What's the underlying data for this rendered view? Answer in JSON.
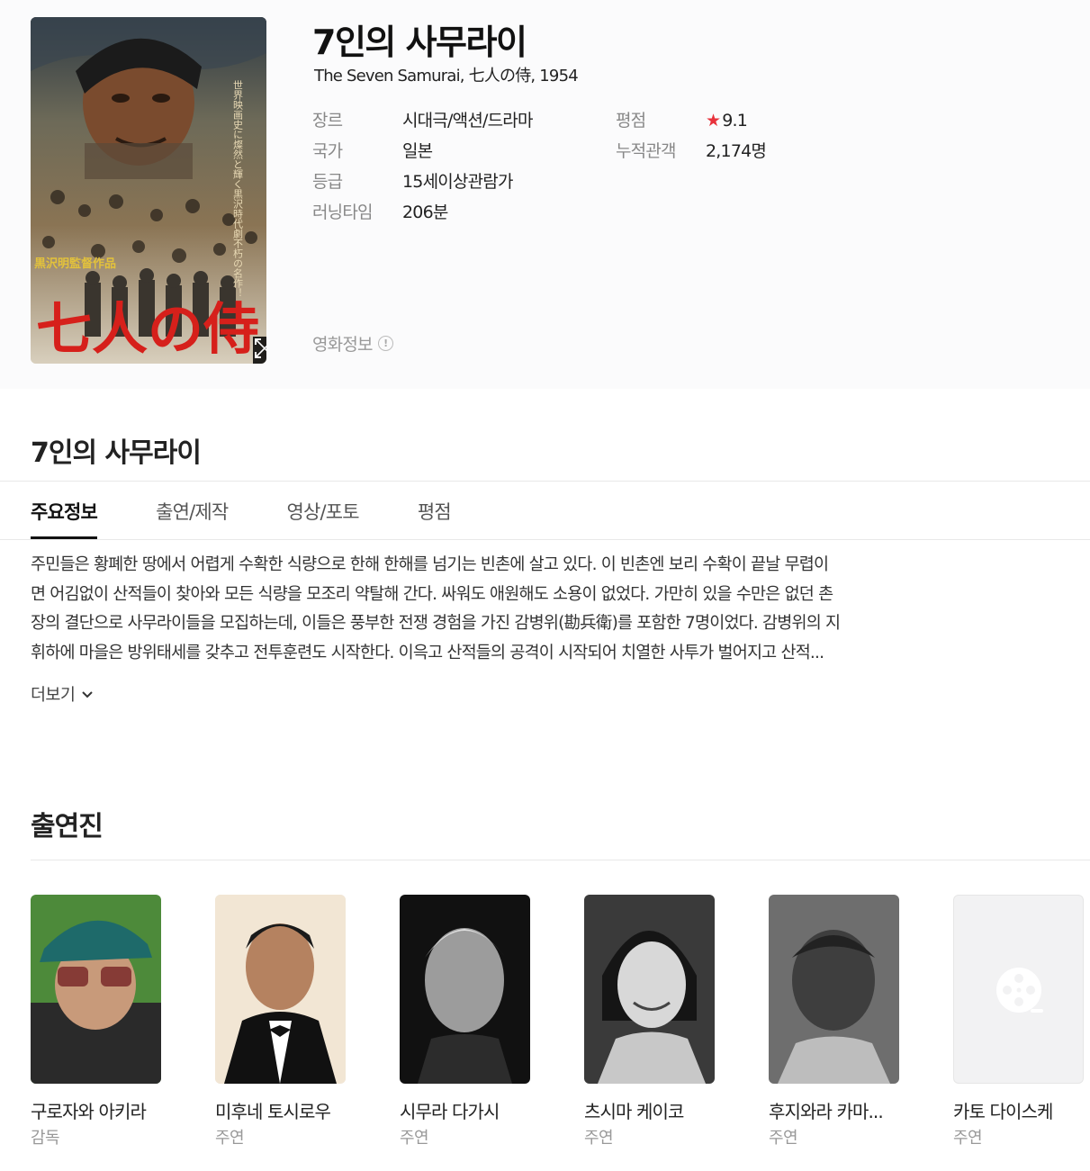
{
  "movie": {
    "title": "7인의 사무라이",
    "subtitle": "The Seven Samurai, 七人の侍, 1954",
    "poster_text_title": "七人の侍",
    "poster_text_credit": "黒沢明監督作品",
    "poster_text_tagline": "世界映画史に燦然と輝く黒沢時代劇不朽の名作！",
    "info_left": [
      {
        "label": "장르",
        "value": "시대극/액션/드라마"
      },
      {
        "label": "국가",
        "value": "일본"
      },
      {
        "label": "등급",
        "value": "15세이상관람가"
      },
      {
        "label": "러닝타임",
        "value": "206분"
      }
    ],
    "info_right": [
      {
        "label": "평점",
        "value": "9.1"
      },
      {
        "label": "누적관객",
        "value": "2,174명"
      }
    ],
    "rating_star_icon": "★",
    "movie_info_link": "영화정보",
    "movie_info_icon": "!"
  },
  "section_title": "7인의 사무라이",
  "tabs": [
    "주요정보",
    "출연/제작",
    "영상/포토",
    "평점"
  ],
  "synopsis": [
    "주민들은 황폐한 땅에서 어렵게 수확한 식량으로 한해 한해를 넘기는 빈촌에 살고 있다. 이 빈촌엔 보리 수확이 끝날 무렵이",
    "면 어김없이 산적들이 찾아와 모든 식량을 모조리 약탈해 간다. 싸워도 애원해도 소용이 없었다. 가만히 있을 수만은 없던 촌",
    "장의 결단으로 사무라이들을 모집하는데, 이들은 풍부한 전쟁 경험을 가진 감병위(勘兵衛)를 포함한 7명이었다. 감병위의 지",
    "휘하에 마을은 방위태세를 갖추고 전투훈련도 시작한다. 이윽고 산적들의 공격이 시작되어 치열한 사투가 벌어지고 산적..."
  ],
  "more_label": "더보기",
  "cast_title": "출연진",
  "cast": [
    {
      "name": "구로자와 아키라",
      "role": "감독"
    },
    {
      "name": "미후네 토시로우",
      "role": "주연"
    },
    {
      "name": "시무라 다가시",
      "role": "주연"
    },
    {
      "name": "츠시마 케이코",
      "role": "주연"
    },
    {
      "name": "후지와라 카마...",
      "role": "주연"
    },
    {
      "name": "카토 다이스케",
      "role": "주연"
    }
  ],
  "colors": {
    "accent_star": "#e8323c",
    "text": "#222222",
    "muted": "#888888"
  }
}
